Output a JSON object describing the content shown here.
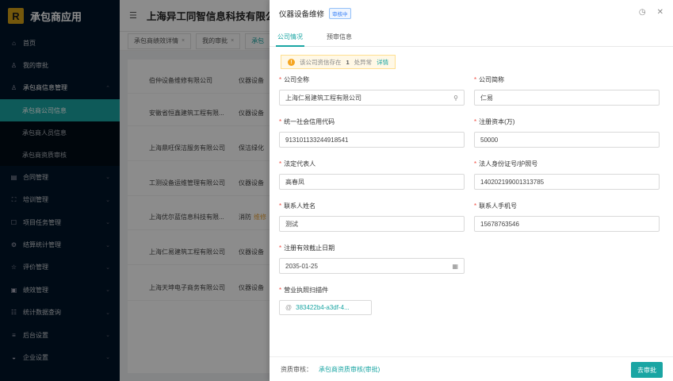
{
  "app": {
    "title": "承包商应用",
    "logo_letter": "R"
  },
  "sidebar": {
    "items": [
      {
        "label": "首页",
        "icon": "home-icon",
        "glyph": "⌂"
      },
      {
        "label": "我的审批",
        "icon": "user-icon",
        "glyph": "♙"
      },
      {
        "label": "承包商信息管理",
        "icon": "user-icon",
        "glyph": "♙",
        "open": true,
        "children": [
          {
            "label": "承包商公司信息",
            "active": true
          },
          {
            "label": "承包商人员信息"
          },
          {
            "label": "承包商资质审核"
          }
        ]
      },
      {
        "label": "合同管理",
        "icon": "document-icon",
        "glyph": "▤"
      },
      {
        "label": "培训管理",
        "icon": "training-icon",
        "glyph": "⛶"
      },
      {
        "label": "项目任务管理",
        "icon": "task-icon",
        "glyph": "☐"
      },
      {
        "label": "结算统计管理",
        "icon": "settings-icon",
        "glyph": "⚙"
      },
      {
        "label": "评价管理",
        "icon": "star-icon",
        "glyph": "☆"
      },
      {
        "label": "绩效管理",
        "icon": "performance-icon",
        "glyph": "▣"
      },
      {
        "label": "统计数据查询",
        "icon": "query-icon",
        "glyph": "☷"
      },
      {
        "label": "后台设置",
        "icon": "backend-icon",
        "glyph": "≡"
      },
      {
        "label": "企业设置",
        "icon": "enterprise-icon",
        "glyph": "◒"
      }
    ]
  },
  "header": {
    "company": "上海异工同智信息科技有限公司"
  },
  "tabs": [
    {
      "label": "承包商绩效详情",
      "closable": true
    },
    {
      "label": "我的审批",
      "closable": true
    },
    {
      "label": "承包",
      "active": true
    }
  ],
  "table": {
    "rows": [
      {
        "name": "伯仲设备维修有限公司",
        "type": "仪器设备"
      },
      {
        "name": "安徽省恒鑫建筑工程有限...",
        "type": "仪器设备"
      },
      {
        "name": "上海鼎旺保洁服务有限公司",
        "type": "保洁绿化"
      },
      {
        "name": "工测设备运维管理有限公司",
        "type": "仪器设备"
      },
      {
        "name": "上海优尔蓝信息科技有限...",
        "type": "消防",
        "tag": "维修"
      },
      {
        "name": "上海仁易建筑工程有限公司",
        "type": "仪器设备"
      },
      {
        "name": "上海天坤电子商务有限公司",
        "type": "仪器设备"
      }
    ]
  },
  "drawer": {
    "title": "仪器设备维修",
    "status_badge": "审核中",
    "tabs": [
      "公司情况",
      "预审信息"
    ],
    "warning": {
      "prefix": "该公司资信存在",
      "count": "1",
      "suffix": "处异常",
      "link": "详情"
    },
    "fields": {
      "full_name": {
        "label": "公司全称",
        "value": "上海仁易建筑工程有限公司"
      },
      "short_name": {
        "label": "公司简称",
        "value": "仁易"
      },
      "credit_code": {
        "label": "统一社会信用代码",
        "value": "913101133244918541"
      },
      "capital": {
        "label": "注册资本(万)",
        "value": "50000"
      },
      "legal_rep": {
        "label": "法定代表人",
        "value": "高春凤"
      },
      "id_number": {
        "label": "法人身份证号/护照号",
        "value": "140202199001313785"
      },
      "contact_name": {
        "label": "联系人姓名",
        "value": "测试"
      },
      "contact_phone": {
        "label": "联系人手机号",
        "value": "15678763546"
      },
      "expiry": {
        "label": "注册有效截止日期",
        "value": "2035-01-25"
      },
      "license": {
        "label": "营业执照扫描件",
        "value": "383422b4-a3df-4..."
      }
    },
    "footer": {
      "label": "资质审核：",
      "link": "承包商资质审核(审批)",
      "button": "去审批"
    }
  },
  "colors": {
    "accent": "#1aa5a3",
    "sidebar_bg": "#001529",
    "required": "#f04b3f",
    "warning": "#f5a623"
  }
}
